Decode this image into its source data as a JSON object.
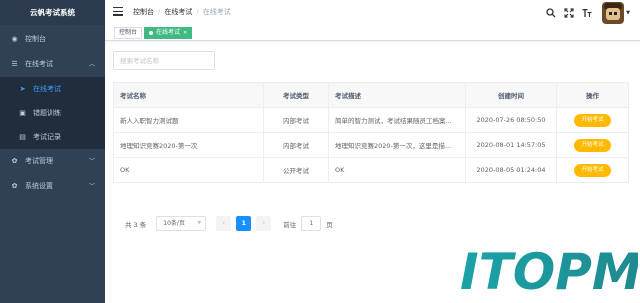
{
  "sidebar": {
    "logo": "云帆考试系统",
    "items": [
      {
        "label": "控制台",
        "icon": "dashboard-icon"
      },
      {
        "label": "在线考试",
        "icon": "list-icon",
        "expanded": true,
        "children": [
          {
            "label": "在线考试",
            "icon": "send-icon",
            "active": true
          },
          {
            "label": "错题训练",
            "icon": "book-icon"
          },
          {
            "label": "考试记录",
            "icon": "record-icon"
          }
        ]
      },
      {
        "label": "考试管理",
        "icon": "gear-icon"
      },
      {
        "label": "系统设置",
        "icon": "settings-icon"
      }
    ]
  },
  "navbar": {
    "breadcrumb": [
      "控制台",
      "在线考试",
      "在线考试"
    ]
  },
  "tags": {
    "items": [
      {
        "label": "控制台"
      },
      {
        "label": "在线考试",
        "active": true
      }
    ]
  },
  "search": {
    "placeholder": "搜索考试名称"
  },
  "table": {
    "columns": [
      "考试名称",
      "考试类型",
      "考试描述",
      "创建时间",
      "操作"
    ],
    "rows": [
      {
        "name": "新人入职智力测试题",
        "type": "内部考试",
        "desc": "简单的智力测试，考试结果随员工档案...",
        "time": "2020-07-26 08:50:50",
        "action": "开始考试"
      },
      {
        "name": "地理知识竞赛2020-第一次",
        "type": "内部考试",
        "desc": "地理知识竞赛2020-第一次，这里是描...",
        "time": "2020-08-01 14:57:05",
        "action": "开始考试"
      },
      {
        "name": "OK",
        "type": "公开考试",
        "desc": "OK",
        "time": "2020-08-05 01:24:04",
        "action": "开始考试"
      }
    ]
  },
  "pagination": {
    "total": "共 3 条",
    "page_size": "10条/页",
    "current": "1",
    "goto_label": "前往",
    "goto_value": "1",
    "page_unit": "页"
  },
  "watermark": {
    "text": "ITOPM"
  },
  "colors": {
    "sidebar_bg": "#304156",
    "active_menu": "#409eff",
    "tag_active": "#42b983",
    "action_btn": "#ffba00",
    "page_active": "#1890ff"
  }
}
